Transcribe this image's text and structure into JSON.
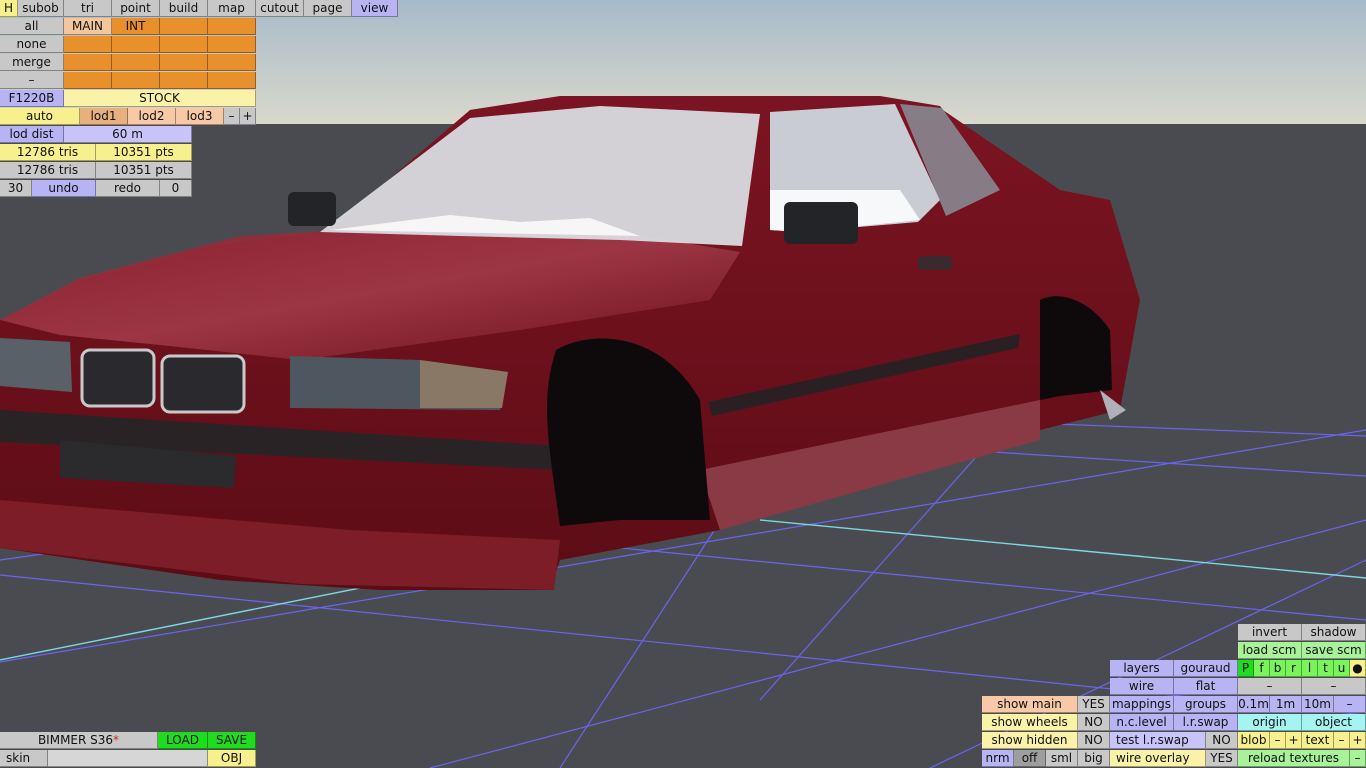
{
  "menu": {
    "h": "H",
    "items": [
      "subob",
      "tri",
      "point",
      "build",
      "map",
      "cutout",
      "page",
      "view"
    ]
  },
  "layers": {
    "all": "all",
    "none": "none",
    "merge": "merge",
    "dash": "–",
    "main": "MAIN",
    "int": "INT"
  },
  "object": {
    "code": "F1220B",
    "variant": "STOCK"
  },
  "lod": {
    "auto": "auto",
    "lod1": "lod1",
    "lod2": "lod2",
    "lod3": "lod3",
    "minus": "–",
    "plus": "+",
    "dist_label": "lod dist",
    "dist_value": "60 m"
  },
  "stats": {
    "tris1": "12786 tris",
    "pts1": "10351 pts",
    "tris2": "12786 tris",
    "pts2": "10351 pts"
  },
  "history": {
    "count": "30",
    "undo": "undo",
    "redo": "redo",
    "redo_count": "0"
  },
  "file": {
    "name": "BIMMER S36",
    "modified_marker": "*",
    "load": "LOAD",
    "save": "SAVE",
    "skin": "skin",
    "obj": "OBJ"
  },
  "view_panel": {
    "invert": "invert",
    "shadow": "shadow",
    "load_scm": "load scm",
    "save_scm": "save scm",
    "layers": "layers",
    "gouraud": "gouraud",
    "wire": "wire",
    "flat": "flat",
    "flags": [
      "P",
      "f",
      "b",
      "r",
      "l",
      "t",
      "u",
      "●"
    ],
    "dash1": "–",
    "dash2": "–",
    "mappings": "mappings",
    "groups": "groups",
    "grid_small": "0.1m",
    "grid_mid": "1m",
    "grid_big": "10m",
    "grid_minus": "–",
    "nc_level": "n.c.level",
    "lr_swap": "l.r.swap",
    "origin": "origin",
    "object": "object",
    "test_lr_swap": "test l.r.swap",
    "test_lr_swap_val": "NO",
    "blob": "blob",
    "blob_minus": "–",
    "blob_plus": "+",
    "text": "text",
    "text_minus": "–",
    "text_plus": "+",
    "wire_overlay": "wire overlay",
    "wire_overlay_val": "YES",
    "reload_textures": "reload textures",
    "reload_minus": "–",
    "show_main": "show main",
    "show_main_val": "YES",
    "show_wheels": "show wheels",
    "show_wheels_val": "NO",
    "show_hidden": "show hidden",
    "show_hidden_val": "NO",
    "nrm": "nrm",
    "off": "off",
    "sml": "sml",
    "big": "big"
  },
  "colors": {
    "sky_top": "#a8bcc8",
    "floor": "#4a4b50",
    "grid": "#6a64f0",
    "axis": "#7ad8e0",
    "car_body": "#6a0f1a"
  }
}
